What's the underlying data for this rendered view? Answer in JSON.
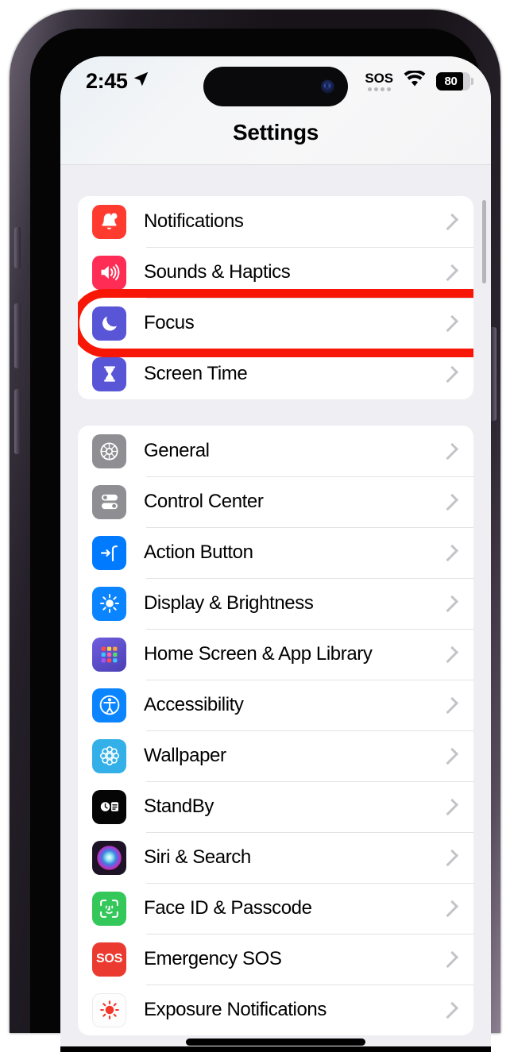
{
  "status_bar": {
    "time": "2:45",
    "location_icon": "location-arrow-icon",
    "sos_label": "SOS",
    "wifi_icon": "wifi-icon",
    "battery_level": "80",
    "battery_percent": 80
  },
  "nav": {
    "title": "Settings"
  },
  "annotation": {
    "type": "red-oval-highlight",
    "target": "Focus",
    "color": "#f81706"
  },
  "groups": [
    {
      "id": "group-1",
      "rows": [
        {
          "label": "Notifications",
          "icon": "bell-icon",
          "icon_color": "#ff3b30"
        },
        {
          "label": "Sounds & Haptics",
          "icon": "speaker-waves-icon",
          "icon_color": "#ff2d55"
        },
        {
          "label": "Focus",
          "icon": "crescent-moon-icon",
          "icon_color": "#5856d6",
          "highlighted": true
        },
        {
          "label": "Screen Time",
          "icon": "hourglass-icon",
          "icon_color": "#5856d6"
        }
      ]
    },
    {
      "id": "group-2",
      "rows": [
        {
          "label": "General",
          "icon": "gear-icon",
          "icon_color": "#8e8e93"
        },
        {
          "label": "Control Center",
          "icon": "sliders-icon",
          "icon_color": "#8e8e93"
        },
        {
          "label": "Action Button",
          "icon": "action-button-icon",
          "icon_color": "#007aff"
        },
        {
          "label": "Display & Brightness",
          "icon": "sun-icon",
          "icon_color": "#0a84ff"
        },
        {
          "label": "Home Screen & App Library",
          "icon": "app-grid-icon",
          "icon_color": "#5f4fd6"
        },
        {
          "label": "Accessibility",
          "icon": "accessibility-icon",
          "icon_color": "#0a84ff"
        },
        {
          "label": "Wallpaper",
          "icon": "flower-icon",
          "icon_color": "#33b0e8"
        },
        {
          "label": "StandBy",
          "icon": "standby-clock-icon",
          "icon_color": "#000000"
        },
        {
          "label": "Siri & Search",
          "icon": "siri-orb-icon",
          "icon_color": "#2a1f3d"
        },
        {
          "label": "Face ID & Passcode",
          "icon": "face-id-icon",
          "icon_color": "#34c759"
        },
        {
          "label": "Emergency SOS",
          "icon": "sos-icon",
          "icon_color": "#eb3b30"
        },
        {
          "label": "Exposure Notifications",
          "icon": "exposure-dot-icon",
          "icon_color": "#ffffff"
        }
      ]
    }
  ]
}
